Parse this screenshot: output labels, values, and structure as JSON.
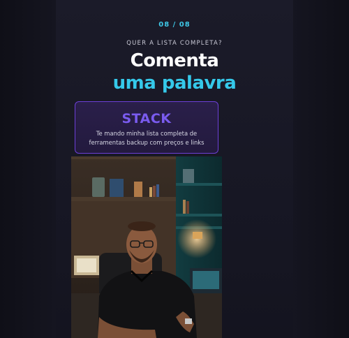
{
  "slide": {
    "counter": "08 / 08",
    "eyebrow": "QUER A LISTA COMPLETA?",
    "headline_line1": "Comenta",
    "headline_line2": "uma palavra"
  },
  "cta": {
    "keyword": "STACK",
    "description": "Te mando minha lista completa de ferramentas backup com preços e links"
  },
  "photo": {
    "subject": "man-at-desk-photo"
  },
  "colors": {
    "accent_cyan": "#35c9ea",
    "accent_purple": "#7a5bef",
    "background": "#15151f"
  }
}
